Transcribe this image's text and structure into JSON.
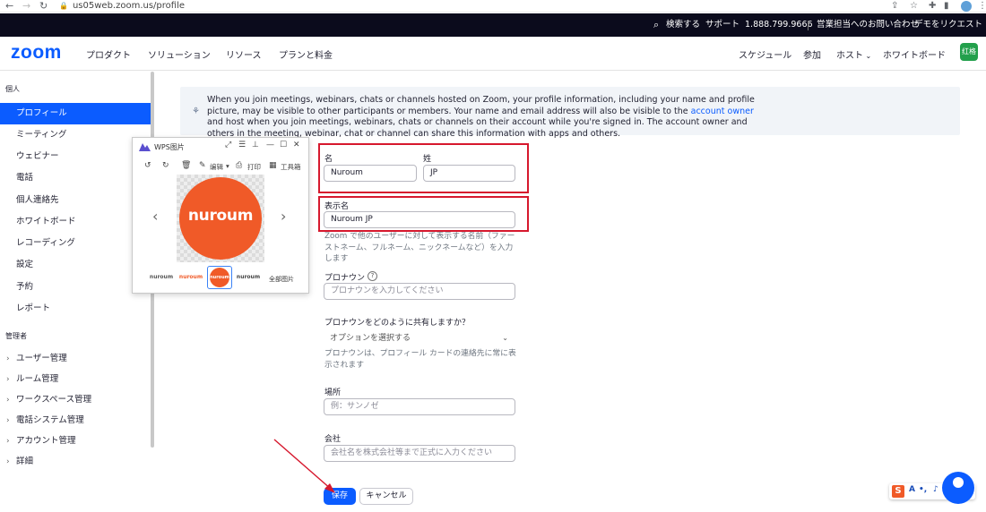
{
  "browser": {
    "url": "us05web.zoom.us/profile"
  },
  "topbar": {
    "search": "検索する",
    "support": "サポート",
    "phone": "1.888.799.9666",
    "contact_sales": "営業担当へのお問い合わせ",
    "request_demo": "デモをリクエスト"
  },
  "header": {
    "logo": "zoom",
    "nav": [
      "プロダクト",
      "ソリューション",
      "リソース",
      "プランと料金"
    ],
    "right_nav": {
      "schedule": "スケジュール",
      "join": "参加",
      "host": "ホスト",
      "whiteboard": "ホワイトボード"
    },
    "avatar": "红格"
  },
  "sidebar": {
    "personal_section": "個人",
    "items": [
      {
        "label": "プロフィール",
        "active": true
      },
      {
        "label": "ミーティング"
      },
      {
        "label": "ウェビナー"
      },
      {
        "label": "電話"
      },
      {
        "label": "個人連絡先"
      },
      {
        "label": "ホワイトボード"
      },
      {
        "label": "レコーディング"
      },
      {
        "label": "設定"
      },
      {
        "label": "予約"
      },
      {
        "label": "レポート"
      }
    ],
    "admin_section": "管理者",
    "admin_items": [
      {
        "label": "ユーザー管理"
      },
      {
        "label": "ルーム管理"
      },
      {
        "label": "ワークスペース管理"
      },
      {
        "label": "電話システム管理"
      },
      {
        "label": "アカウント管理"
      },
      {
        "label": "詳細"
      }
    ]
  },
  "notice": {
    "text_before": "When you join meetings, webinars, chats or channels hosted on Zoom, your profile information, including your name and profile picture, may be visible to other participants or members. Your name and email address will also be visible to the ",
    "link": "account owner",
    "text_after": " and host when you join meetings, webinars, chats or channels on their account while you're signed in. The account owner and others in the meeting, webinar, chat or channel can share this information with apps and others."
  },
  "form": {
    "first_name_label": "名",
    "first_name_value": "Nuroum",
    "last_name_label": "姓",
    "last_name_value": "JP",
    "display_name_label": "表示名",
    "display_name_value": "Nuroum JP",
    "display_name_help": "Zoom で他のユーザーに対して表示する名前（ファーストネーム、フルネーム、ニックネームなど）を入力します",
    "pronoun_label": "プロナウン",
    "pronoun_placeholder": "プロナウンを入力してください",
    "pronoun_share_label": "プロナウンをどのように共有しますか？",
    "pronoun_share_select": "オプションを選択する",
    "pronoun_share_help": "プロナウンは、プロフィール カードの連絡先に常に表示されます",
    "location_label": "場所",
    "location_placeholder": "例：サンノゼ",
    "company_label": "会社",
    "company_placeholder": "会社名を株式会社等まで正式に入力ください",
    "save": "保存",
    "cancel": "キャンセル"
  },
  "wps": {
    "title": "WPS图片",
    "edit": "编辑",
    "print": "打印",
    "tools": "工具箱",
    "brand": "nuroum",
    "all_images": "全部图片",
    "thumbnails": [
      "nuroum",
      "nuroum",
      "nuroum",
      "nuroum"
    ]
  },
  "colors": {
    "zoom_blue": "#0b5cff",
    "brand_orange": "#f05a28",
    "highlight_red": "#d6182d"
  }
}
